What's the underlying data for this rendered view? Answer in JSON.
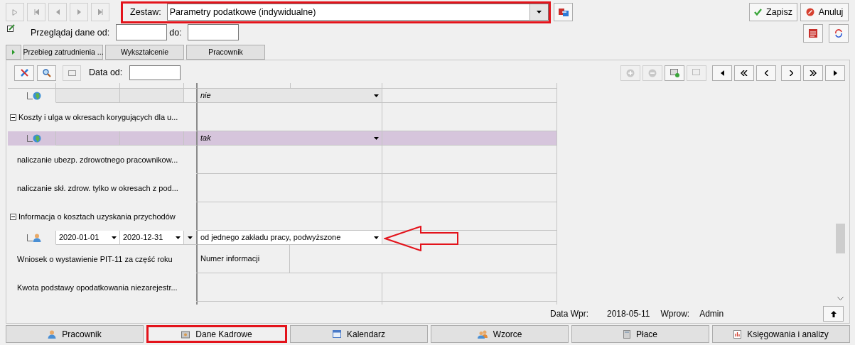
{
  "zestaw": {
    "label": "Zestaw:",
    "value": "Parametry podatkowe (indywidualne)",
    "highlighted": true
  },
  "actions": [
    {
      "label": "Zapisz",
      "kind": "save"
    },
    {
      "label": "Anuluj",
      "kind": "cancel"
    }
  ],
  "browse": {
    "label": "Przeglądaj dane od:",
    "to_label": "do:"
  },
  "tabs": [
    {
      "label": "Przebieg zatrudnienia ...",
      "selected": false
    },
    {
      "label": "Wykształcenie",
      "selected": false
    },
    {
      "label": "Pracownik",
      "selected": false
    }
  ],
  "toolbar": {
    "date_label": "Data od:"
  },
  "grid": {
    "rows": [
      {
        "kind": "value",
        "value": "nie",
        "selected": false
      },
      {
        "kind": "group",
        "label": "Koszty i ulga w okresach korygujących dla u...",
        "expanded": true
      },
      {
        "kind": "value",
        "value": "tak",
        "selected": true
      },
      {
        "kind": "param",
        "label": "naliczanie ubezp. zdrowotnego pracownikow..."
      },
      {
        "kind": "param",
        "label": "naliczanie skł. zdrow. tylko w okresach z pod..."
      },
      {
        "kind": "group",
        "label": "Informacja o kosztach uzyskania przychodów",
        "expanded": true
      },
      {
        "kind": "period",
        "from": "2020-01-01",
        "to": "2020-12-31",
        "value": "od jednego zakładu pracy, podwyższone",
        "selected": false,
        "arrow": true
      },
      {
        "kind": "split",
        "label": "Wniosek o wystawienie PIT-11 za część roku",
        "value_label": "Numer informacji"
      },
      {
        "kind": "param",
        "label": "Kwota podstawy opodatkowania niezarejestr..."
      }
    ]
  },
  "status": {
    "date_label": "Data Wpr:",
    "date": "2018-05-11",
    "user_label": "Wprow:",
    "user": "Admin"
  },
  "modules": [
    {
      "label": "Pracownik",
      "selected": false,
      "kind": "person"
    },
    {
      "label": "Dane Kadrowe",
      "selected": true,
      "kind": "folder"
    },
    {
      "label": "Kalendarz",
      "selected": false,
      "kind": "calendar"
    },
    {
      "label": "Wzorce",
      "selected": false,
      "kind": "people"
    },
    {
      "label": "Płace",
      "selected": false,
      "kind": "calculator"
    },
    {
      "label": "Księgowania i analizy",
      "selected": false,
      "kind": "report"
    }
  ]
}
